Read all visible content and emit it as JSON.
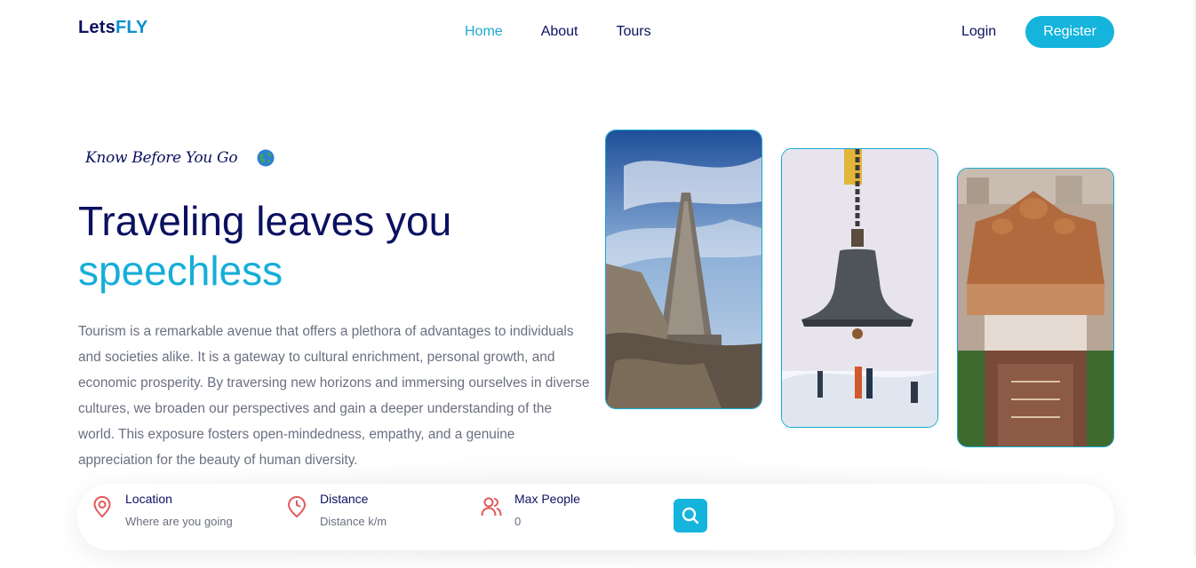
{
  "brand": {
    "part1": "Lets",
    "part2": "FLY"
  },
  "nav": {
    "items": [
      "Home",
      "About",
      "Tours"
    ],
    "active": "Home"
  },
  "auth": {
    "login": "Login",
    "register": "Register"
  },
  "hero": {
    "subtitle": "Know Before You Go",
    "title_line1": "Traveling leaves you",
    "title_line2": "speechless",
    "description": "Tourism is a remarkable avenue that offers a plethora of advantages to individuals and societies alike. It is a gateway to cultural enrichment, personal growth, and economic prosperity. By traversing new horizons and immersing ourselves in diverse cultures, we broaden our perspectives and gain a deeper understanding of the world. This exposure fosters open-mindedness, empathy, and a genuine appreciation for the beauty of human diversity."
  },
  "images": [
    "temple-gopuram-photo",
    "temple-bell-photo",
    "akshardham-temple-photo"
  ],
  "search": {
    "location": {
      "label": "Location",
      "placeholder": "Where are you going",
      "icon": "map-pin-icon"
    },
    "distance": {
      "label": "Distance",
      "placeholder": "Distance k/m",
      "icon": "clock-pin-icon"
    },
    "max_people": {
      "label": "Max People",
      "placeholder": "0",
      "icon": "users-icon"
    },
    "button_icon": "search-icon"
  },
  "colors": {
    "navy": "#0b1160",
    "accent": "#14b4dc",
    "brand_blue": "#0d8fd0",
    "icon_red": "#e05a5a",
    "text_gray": "#6b6f80"
  }
}
